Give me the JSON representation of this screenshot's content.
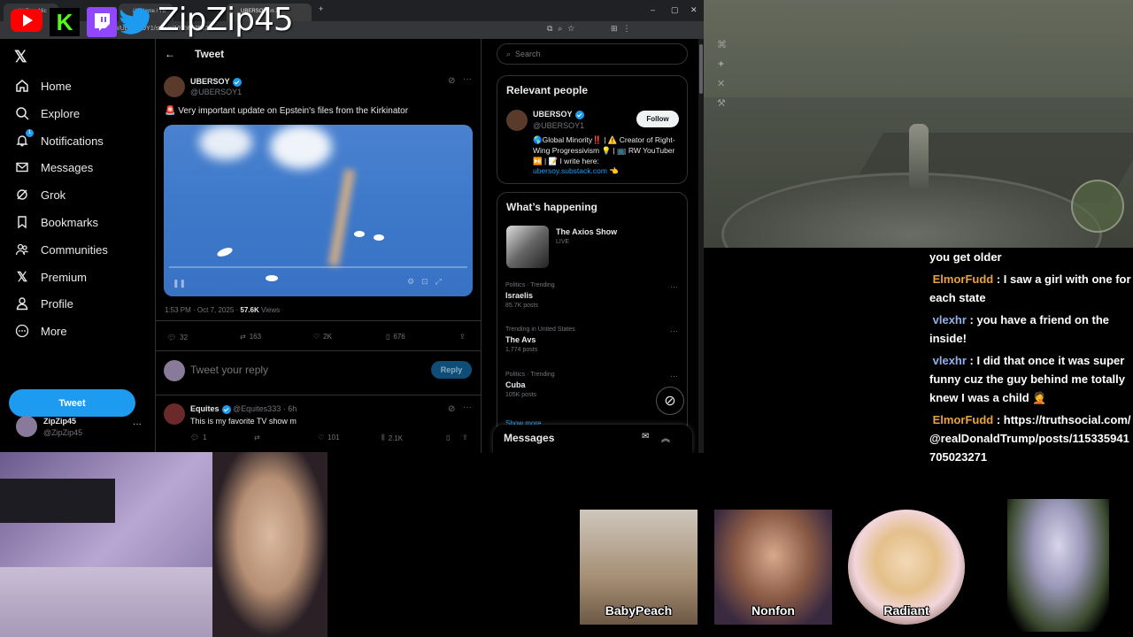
{
  "browser": {
    "tabs": [
      "(1) Tony Mic",
      "(1) Home / Tw",
      "UBERSOY on X"
    ],
    "url": "x.com/UBERSOY1/status/1975627562"
  },
  "overlay": {
    "channel_name": "ZipZip45"
  },
  "nav": {
    "items": [
      {
        "label": "Home",
        "icon": "home-icon"
      },
      {
        "label": "Explore",
        "icon": "search-icon"
      },
      {
        "label": "Notifications",
        "icon": "bell-icon"
      },
      {
        "label": "Messages",
        "icon": "mail-icon"
      },
      {
        "label": "Grok",
        "icon": "grok-icon"
      },
      {
        "label": "Bookmarks",
        "icon": "bookmark-icon"
      },
      {
        "label": "Communities",
        "icon": "people-icon"
      },
      {
        "label": "Premium",
        "icon": "x-icon"
      },
      {
        "label": "Profile",
        "icon": "person-icon"
      },
      {
        "label": "More",
        "icon": "more-icon"
      }
    ],
    "notification_badge": "1",
    "post_label": "Tweet",
    "account": {
      "name": "ZipZip45",
      "handle": "@ZipZip45"
    }
  },
  "tweet": {
    "header": "Tweet",
    "author_name": "UBERSOY",
    "author_handle": "@UBERSOY1",
    "text": "🚨 Very important update on Epstein's files from the Kirkinator",
    "time": "1:53 PM · Oct 7, 2025 · ",
    "views_count": "57.6K",
    "views_label": " Views",
    "replies": "32",
    "retweets": "163",
    "likes": "2K",
    "bookmarks": "676",
    "reply_placeholder": "Tweet your reply",
    "reply_button": "Reply"
  },
  "reply": {
    "author_name": "Equites",
    "author_handle": "@Equites333 · 6h",
    "text": "This is my favorite TV show m",
    "replies": "1",
    "likes": "101",
    "views": "2.1K"
  },
  "right": {
    "search_placeholder": "Search",
    "relevant_title": "Relevant people",
    "person_name": "UBERSOY",
    "person_handle": "@UBERSOY1",
    "follow_label": "Follow",
    "bio": "🌎Global Minority‼️ | ⚠️ Creator of Right-Wing Progressivism 💡 | 📺 RW YouTuber ⏯️ | 📝 I write here:",
    "bio_link": "ubersoy.substack.com 👈",
    "happening_title": "What’s happening",
    "show_name": "The Axios Show",
    "show_status": "LIVE",
    "trends": [
      {
        "category": "Politics · Trending",
        "name": "Israelis",
        "count": "85.7K posts"
      },
      {
        "category": "Trending in United States",
        "name": "The Avs",
        "count": "1,774 posts"
      },
      {
        "category": "Politics · Trending",
        "name": "Cuba",
        "count": "105K posts"
      }
    ],
    "show_more": "Show more",
    "messages_title": "Messages"
  },
  "chat": {
    "lines": [
      {
        "user": "",
        "text": "you get older"
      },
      {
        "user": "ElmorFudd",
        "text": " : I saw a girl with one for each state"
      },
      {
        "user": "vlexhr",
        "text": " : you have a friend on the inside!"
      },
      {
        "user": "vlexhr",
        "text": " : I did that once it was super funny cuz the guy behind me totally knew I was a child 🤦"
      },
      {
        "user": "ElmorFudd",
        "text": " : https://truthsocial.com/@realDonaldTrump/posts/115335941705023271"
      }
    ]
  },
  "avatars": [
    {
      "label": "BabyPeach"
    },
    {
      "label": "Nonfon"
    },
    {
      "label": "Radiant"
    },
    {
      "label": ""
    }
  ],
  "colors": {
    "accent": "#1d9bf0",
    "elmor": "#e8a33a",
    "vlex": "#8fb0e8"
  }
}
